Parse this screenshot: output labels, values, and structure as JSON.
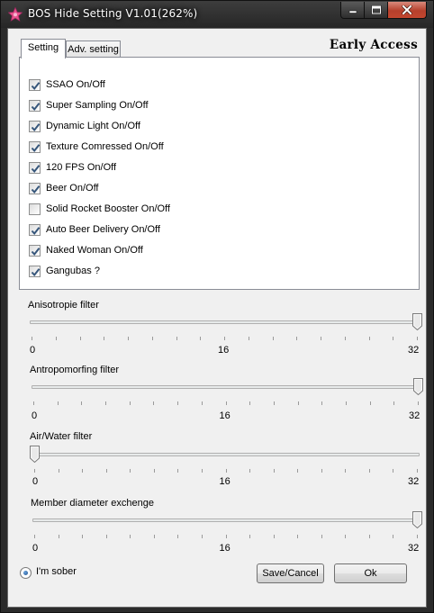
{
  "window": {
    "title": "BOS Hide Setting V1.01(262%)",
    "app_icon": "pink-star-icon",
    "caption_buttons": [
      "minimize-icon",
      "maximize-icon",
      "close-icon"
    ]
  },
  "tabs": [
    {
      "label": "Setting",
      "active": true
    },
    {
      "label": "Adv. setting",
      "active": false
    }
  ],
  "badge": "Early Access",
  "options": [
    {
      "label": "SSAO On/Off",
      "checked": true
    },
    {
      "label": "Super Sampling On/Off",
      "checked": true
    },
    {
      "label": "Dynamic Light On/Off",
      "checked": true
    },
    {
      "label": "Texture Comressed On/Off",
      "checked": true
    },
    {
      "label": "120 FPS  On/Off",
      "checked": true
    },
    {
      "label": "Beer  On/Off",
      "checked": true
    },
    {
      "label": "Solid Rocket Booster On/Off",
      "checked": false
    },
    {
      "label": "Auto Beer Delivery On/Off",
      "checked": true
    },
    {
      "label": "Naked Woman On/Off",
      "checked": true
    },
    {
      "label": "Gangubas ?",
      "checked": true
    }
  ],
  "sliders": [
    {
      "label": "Anisotropie filter",
      "min": "0",
      "mid": "16",
      "max": "32",
      "value": 32
    },
    {
      "label": "Antropomorfing filter",
      "min": "0",
      "mid": "16",
      "max": "32",
      "value": 32
    },
    {
      "label": "Air/Water filter",
      "min": "0",
      "mid": "16",
      "max": "32",
      "value": 0
    },
    {
      "label": "Member diameter exchenge",
      "min": "0",
      "mid": "16",
      "max": "32",
      "value": 32
    }
  ],
  "radio": {
    "label": "I'm sober",
    "selected": true
  },
  "buttons": {
    "save_cancel": "Save/Cancel",
    "ok": "Ok"
  },
  "colors": {
    "title_bar": "#2b2b2b",
    "close_button": "#c2462f",
    "dialog_bg": "#f0f0f0",
    "check_mark": "#35557a"
  }
}
